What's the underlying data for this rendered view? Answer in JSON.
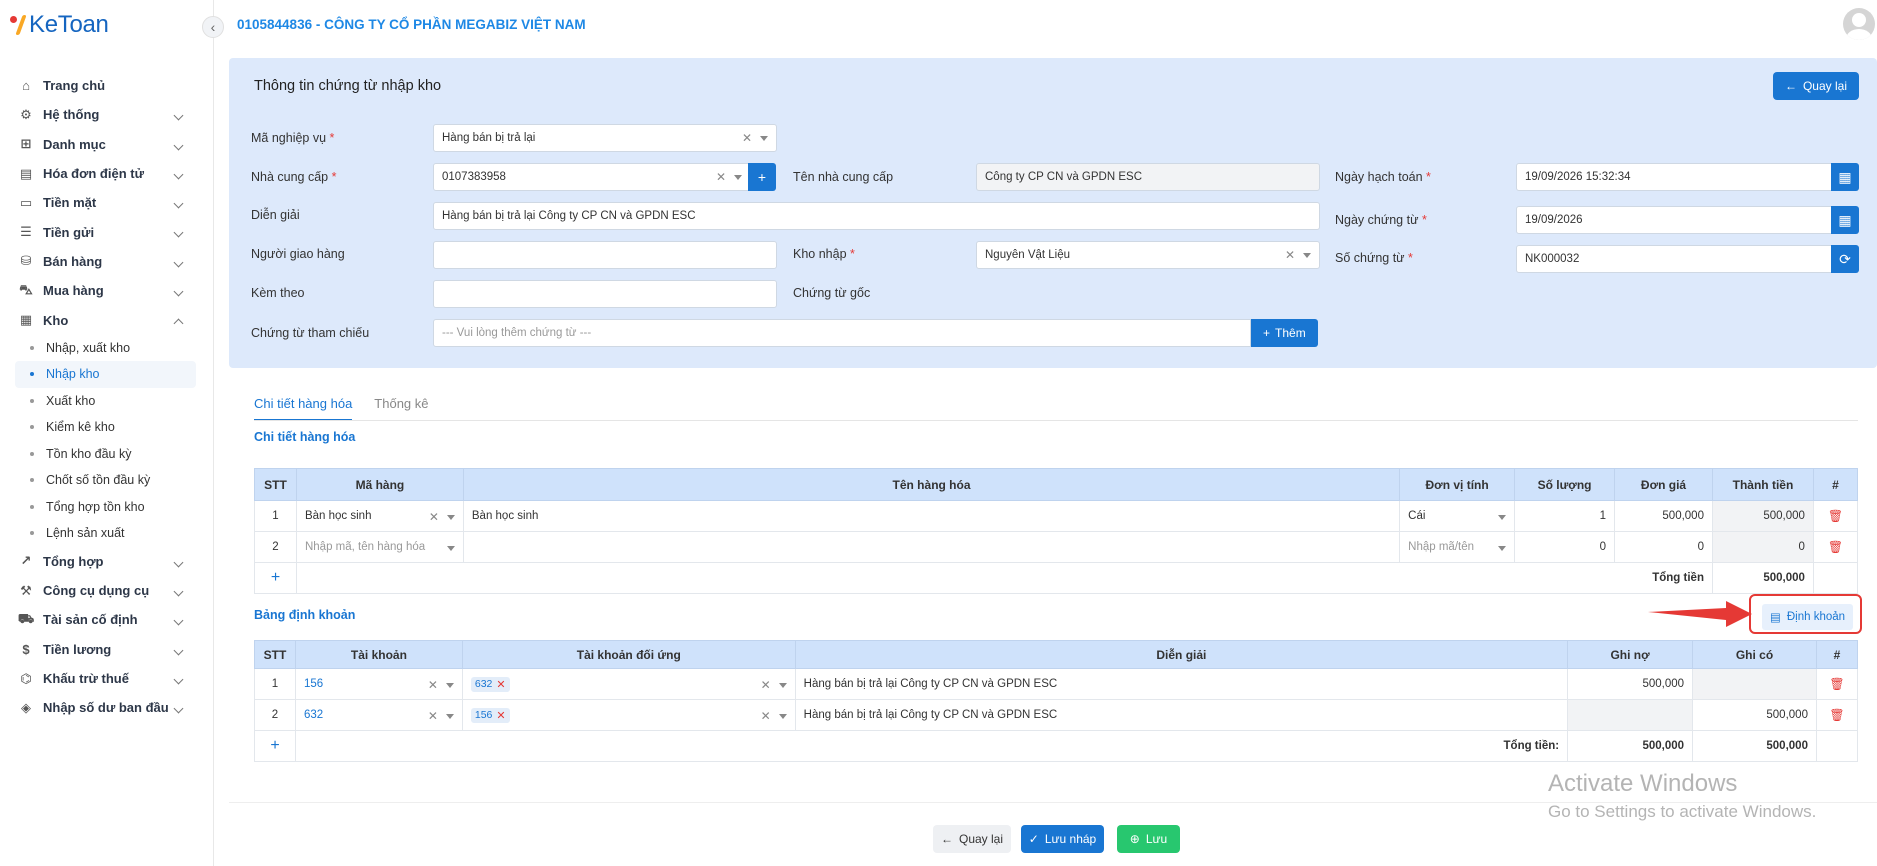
{
  "app": {
    "logo_text": "KeToan",
    "company": "0105844836 - CÔNG TY CỔ PHẦN MEGABIZ VIỆT NAM"
  },
  "sidebar": {
    "items": [
      {
        "label": "Trang chủ",
        "icon": "home-icon",
        "chevron": false
      },
      {
        "label": "Hệ thống",
        "icon": "gear-icon",
        "chevron": true
      },
      {
        "label": "Danh mục",
        "icon": "grid-icon",
        "chevron": true
      },
      {
        "label": "Hóa đơn điện tử",
        "icon": "invoice-icon",
        "chevron": true
      },
      {
        "label": "Tiền mặt",
        "icon": "cash-icon",
        "chevron": true
      },
      {
        "label": "Tiền gửi",
        "icon": "bank-icon",
        "chevron": true
      },
      {
        "label": "Bán hàng",
        "icon": "sales-icon",
        "chevron": true
      },
      {
        "label": "Mua hàng",
        "icon": "cart-icon",
        "chevron": true
      },
      {
        "label": "Kho",
        "icon": "warehouse-icon",
        "chevron": true,
        "expanded": true
      }
    ],
    "kho_sub": [
      "Nhập, xuất kho",
      "Nhập kho",
      "Xuất kho",
      "Kiểm kê kho",
      "Tồn kho đầu kỳ",
      "Chốt số tồn đầu kỳ",
      "Tổng hợp tồn kho",
      "Lệnh sản xuất"
    ],
    "kho_active": "Nhập kho",
    "items2": [
      {
        "label": "Tổng hợp",
        "icon": "chart-icon"
      },
      {
        "label": "Công cụ dụng cụ",
        "icon": "tools-icon"
      },
      {
        "label": "Tài sản cố định",
        "icon": "car-icon"
      },
      {
        "label": "Tiền lương",
        "icon": "dollar-icon"
      },
      {
        "label": "Khấu trừ thuế",
        "icon": "tax-icon"
      },
      {
        "label": "Nhập số dư ban đầu",
        "icon": "balance-icon"
      }
    ]
  },
  "form": {
    "title": "Thông tin chứng từ nhập kho",
    "back_label": "Quay lại",
    "ma_nghiep_vu_label": "Mã nghiệp vụ",
    "ma_nghiep_vu_value": "Hàng bán bị trả lại",
    "nha_cung_cap_label": "Nhà cung cấp",
    "nha_cung_cap_value": "0107383958",
    "ten_ncc_label": "Tên nhà cung cấp",
    "ten_ncc_value": "Công ty CP CN và GPDN ESC",
    "ngay_hach_toan_label": "Ngày hạch toán",
    "ngay_hach_toan_value": "19/09/2026 15:32:34",
    "dien_giai_label": "Diễn giải",
    "dien_giai_value": "Hàng bán bị trả lại Công ty CP CN và GPDN ESC",
    "ngay_chung_tu_label": "Ngày chứng từ",
    "ngay_chung_tu_value": "19/09/2026",
    "nguoi_giao_hang_label": "Người giao hàng",
    "kho_nhap_label": "Kho nhập",
    "kho_nhap_value": "Nguyên Vật Liệu",
    "so_chung_tu_label": "Số chứng từ",
    "so_chung_tu_value": "NK000032",
    "kem_theo_label": "Kèm theo",
    "chung_tu_goc_label": "Chứng từ gốc",
    "chung_tu_tham_chieu_label": "Chứng từ tham chiếu",
    "chung_tu_tham_chieu_placeholder": "--- Vui lòng thêm chứng từ ---",
    "them_label": "Thêm"
  },
  "tabs": [
    {
      "label": "Chi tiết hàng hóa",
      "active": true
    },
    {
      "label": "Thống kê",
      "active": false
    }
  ],
  "goods": {
    "section_title": "Chi tiết hàng hóa",
    "headers": [
      "STT",
      "Mã hàng",
      "Tên hàng hóa",
      "Đơn vị tính",
      "Số lượng",
      "Đơn giá",
      "Thành tiền",
      "#"
    ],
    "rows": [
      {
        "stt": "1",
        "ma": "Bàn học sinh",
        "ten": "Bàn học sinh",
        "dvt": "Cái",
        "sl": "1",
        "dg": "500,000",
        "tt": "500,000"
      },
      {
        "stt": "2",
        "ma": "Nhập mã, tên hàng hóa",
        "ten": "",
        "dvt": "Nhập mã/tên",
        "sl": "0",
        "dg": "0",
        "tt": "0"
      }
    ],
    "total_label": "Tổng tiền",
    "total_value": "500,000"
  },
  "accounting": {
    "section_title": "Bảng định khoản",
    "dinh_khoan_label": "Định khoản",
    "headers": [
      "STT",
      "Tài khoản",
      "Tài khoản đối ứng",
      "Diễn giải",
      "Ghi nợ",
      "Ghi có",
      "#"
    ],
    "rows": [
      {
        "stt": "1",
        "tk": "156",
        "tkdu": "632",
        "dg": "Hàng bán bị trả lại Công ty CP CN và GPDN ESC",
        "no": "500,000",
        "co": ""
      },
      {
        "stt": "2",
        "tk": "632",
        "tkdu": "156",
        "dg": "Hàng bán bị trả lại Công ty CP CN và GPDN ESC",
        "no": "",
        "co": "500,000"
      }
    ],
    "total_label": "Tổng tiền:",
    "total_no": "500,000",
    "total_co": "500,000"
  },
  "footer": {
    "back": "Quay lại",
    "save_draft": "Lưu nháp",
    "save": "Lưu"
  },
  "watermark": {
    "line1": "Activate Windows",
    "line2": "Go to Settings to activate Windows."
  },
  "colors": {
    "primary": "#1976d2",
    "success": "#28c76f",
    "danger": "#e53935",
    "panel": "#dde9fb"
  }
}
